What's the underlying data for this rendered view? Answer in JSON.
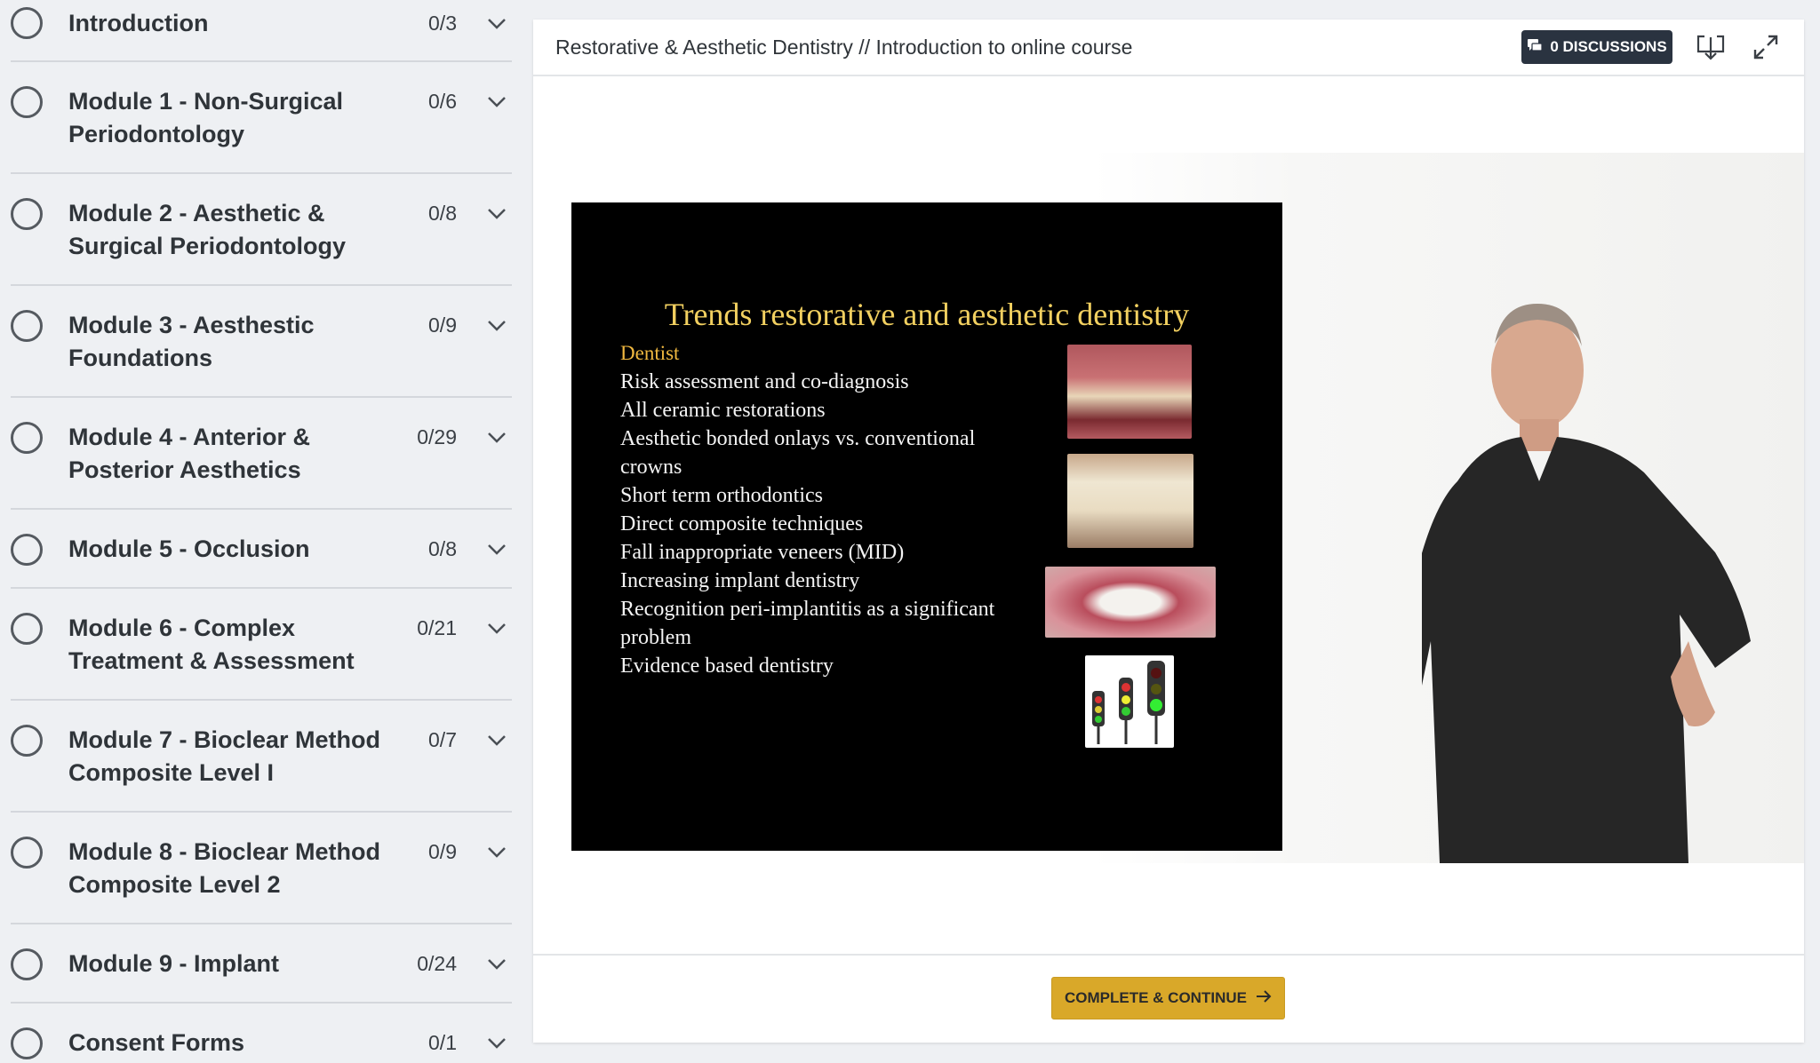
{
  "sidebar": {
    "modules": [
      {
        "title": "Introduction",
        "progress": "0/3"
      },
      {
        "title": "Module 1 - Non-Surgical Periodontology",
        "progress": "0/6"
      },
      {
        "title": "Module 2 - Aesthetic & Surgical Periodontology",
        "progress": "0/8"
      },
      {
        "title": "Module 3 - Aesthestic Foundations",
        "progress": "0/9"
      },
      {
        "title": "Module 4 - Anterior & Posterior Aesthetics",
        "progress": "0/29"
      },
      {
        "title": "Module 5 - Occlusion",
        "progress": "0/8"
      },
      {
        "title": "Module 6 - Complex Treatment & Assessment",
        "progress": "0/21"
      },
      {
        "title": "Module 7 - Bioclear Method Composite Level I",
        "progress": "0/7"
      },
      {
        "title": "Module 8 - Bioclear Method Composite Level 2",
        "progress": "0/9"
      },
      {
        "title": "Module 9 - Implant",
        "progress": "0/24"
      },
      {
        "title": "Consent Forms",
        "progress": "0/1"
      }
    ]
  },
  "header": {
    "breadcrumb": "Restorative & Aesthetic Dentistry // Introduction to online course",
    "discussions_label": "0 DISCUSSIONS",
    "download_icon": "download-icon",
    "fullscreen_icon": "expand-icon"
  },
  "slide": {
    "title": "Trends restorative and aesthetic dentistry",
    "subtitle": "Dentist",
    "items": [
      "Risk assessment and co-diagnosis",
      "All ceramic restorations",
      "Aesthetic bonded onlays vs. conventional",
      "crowns",
      "Short term orthodontics",
      "Direct composite techniques",
      "Fall inappropriate veneers (MID)",
      "Increasing implant dentistry",
      "Recognition peri-implantitis as a significant",
      "problem",
      "Evidence based dentistry"
    ]
  },
  "footer": {
    "cta_label": "COMPLETE & CONTINUE",
    "cta_icon": "arrow-right-icon"
  },
  "colors": {
    "accent": "#d9a829",
    "discussions_bg": "#2a3340",
    "slide_title": "#f2d060"
  }
}
